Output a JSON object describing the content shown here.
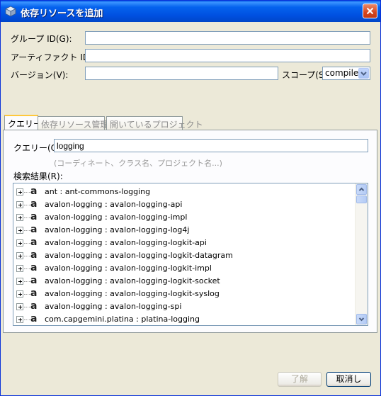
{
  "window": {
    "title": "依存リソースを追加",
    "colors": {
      "titlebar": "#0054e3",
      "panel": "#ece9d8",
      "border": "#7f9db9"
    }
  },
  "form": {
    "group_id_label": "グループ ID(G):",
    "group_id_value": "",
    "artifact_id_label": "アーティファクト ID(A):",
    "artifact_id_value": "",
    "version_label": "バージョン(V):",
    "version_value": "",
    "scope_label": "スコープ(S):",
    "scope_value": "compile"
  },
  "tabs": [
    {
      "label": "クエリー",
      "active": true
    },
    {
      "label": "依存リソース管理",
      "active": false
    },
    {
      "label": "開いているプロジェクト",
      "active": false
    }
  ],
  "query": {
    "label": "クエリー(Q):",
    "value": "logging",
    "hint": "(コーディネート、クラス名、プロジェクト名...)",
    "results_label": "検索結果(R):"
  },
  "results": [
    {
      "icon": "artifact-icon",
      "text": "ant : ant-commons-logging"
    },
    {
      "icon": "artifact-icon",
      "text": "avalon-logging : avalon-logging-api"
    },
    {
      "icon": "artifact-icon",
      "text": "avalon-logging : avalon-logging-impl"
    },
    {
      "icon": "artifact-icon",
      "text": "avalon-logging : avalon-logging-log4j"
    },
    {
      "icon": "artifact-icon",
      "text": "avalon-logging : avalon-logging-logkit-api"
    },
    {
      "icon": "artifact-icon",
      "text": "avalon-logging : avalon-logging-logkit-datagram"
    },
    {
      "icon": "artifact-icon",
      "text": "avalon-logging : avalon-logging-logkit-impl"
    },
    {
      "icon": "artifact-icon",
      "text": "avalon-logging : avalon-logging-logkit-socket"
    },
    {
      "icon": "artifact-icon",
      "text": "avalon-logging : avalon-logging-logkit-syslog"
    },
    {
      "icon": "artifact-icon",
      "text": "avalon-logging : avalon-logging-spi"
    },
    {
      "icon": "artifact-icon",
      "text": "com.capgemini.platina : platina-logging"
    }
  ],
  "buttons": {
    "ok_label": "了解",
    "cancel_label": "取消し"
  }
}
